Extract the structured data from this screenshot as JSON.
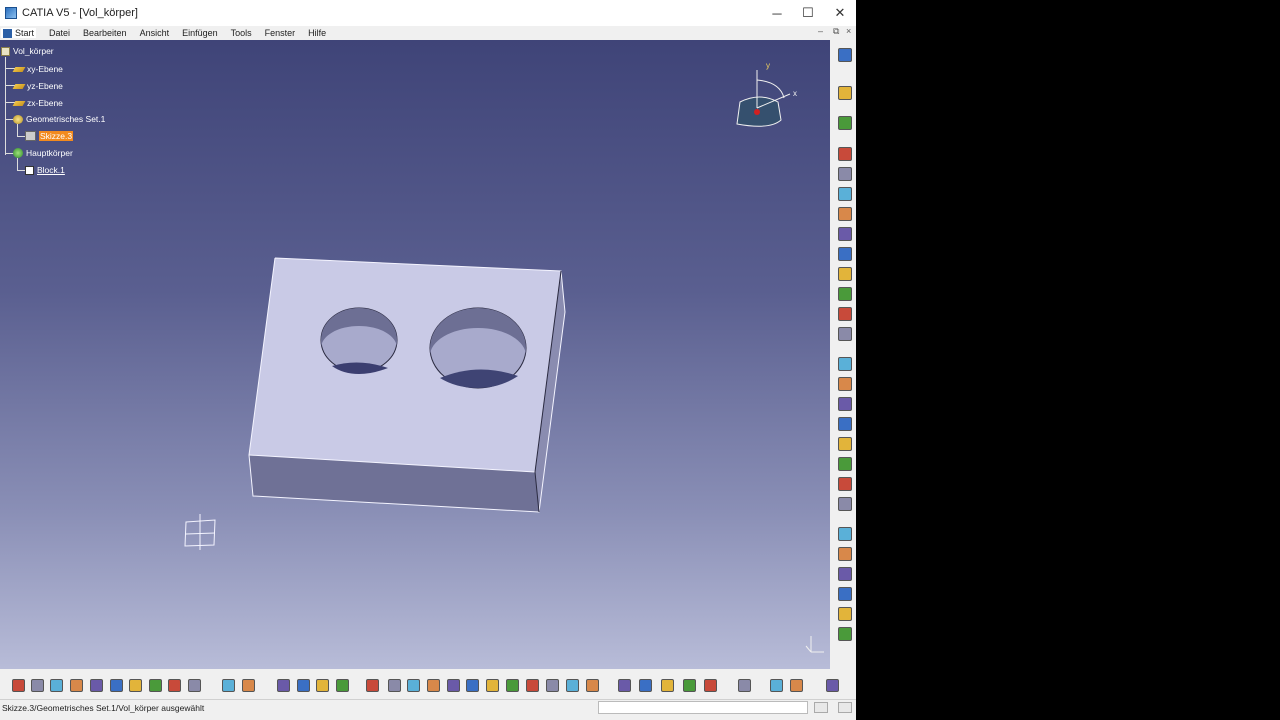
{
  "window": {
    "title": "CATIA V5 - [Vol_körper]",
    "controls": {
      "minimize": "─",
      "maximize": "☐",
      "close": "✕"
    }
  },
  "menubar": {
    "items": [
      {
        "label": "Start"
      },
      {
        "label": "Datei"
      },
      {
        "label": "Bearbeiten"
      },
      {
        "label": "Ansicht"
      },
      {
        "label": "Einfügen"
      },
      {
        "label": "Tools"
      },
      {
        "label": "Fenster"
      },
      {
        "label": "Hilfe"
      }
    ],
    "inner_controls": {
      "minimize": "–",
      "restore": "⧉",
      "close": "×"
    }
  },
  "tree": {
    "root": "Vol_körper",
    "planes": [
      "xy-Ebene",
      "yz-Ebene",
      "zx-Ebene"
    ],
    "geo_set": "Geometrisches Set.1",
    "sketch": "Skizze.3",
    "body": "Hauptkörper",
    "pad": "Block.1"
  },
  "compass": {
    "x_label": "x",
    "y_label": "y"
  },
  "statusbar": {
    "text": "Skizze.3/Geometrisches Set.1/Vol_körper ausgewählt"
  },
  "colors": {
    "viewport_top": "#3f4478",
    "viewport_bottom": "#b8bcd8",
    "part_top": "#c9cae6",
    "part_side": "#6f7196",
    "selection": "#f28a1e",
    "accent_blue": "#2b5fa6"
  },
  "icons": {
    "right_toolbar": [
      "gear-icon",
      "select-arrow-icon",
      "sketch-icon",
      "pad-icon",
      "pocket-icon",
      "shaft-icon",
      "groove-icon",
      "hole-icon",
      "rib-icon",
      "slot-icon",
      "stiffener-icon",
      "multi-section-icon",
      "removed-multi-section-icon",
      "fillet-icon",
      "chamfer-icon",
      "draft-icon",
      "shell-icon",
      "thickness-icon",
      "thread-icon",
      "split-icon",
      "thick-surface-icon",
      "close-surface-icon",
      "sew-surface-icon",
      "mirror-icon",
      "pattern-icon",
      "scale-icon",
      "axis-system-icon"
    ],
    "bottom_toolbar": [
      "new-icon",
      "open-icon",
      "save-icon",
      "quick-save-icon",
      "cut-icon",
      "copy-icon",
      "paste-icon",
      "undo-icon",
      "redo-icon",
      "help-icon",
      "formula-icon",
      "comment-icon",
      "measure-icon",
      "table-icon",
      "knowledge-icon",
      "publication-icon",
      "parameter-icon",
      "fly-icon",
      "fit-all-icon",
      "pan-icon",
      "rotate-icon",
      "zoom-in-icon",
      "zoom-out-icon",
      "normal-view-icon",
      "iso-view-icon",
      "multi-view-icon",
      "shading-icon",
      "hide-show-icon",
      "swap-icon",
      "update-icon",
      "settings-icon",
      "catalog-icon",
      "analysis-icon",
      "render-icon",
      "cut-plane-icon",
      "compass-icon",
      "catia-logo-icon"
    ]
  }
}
